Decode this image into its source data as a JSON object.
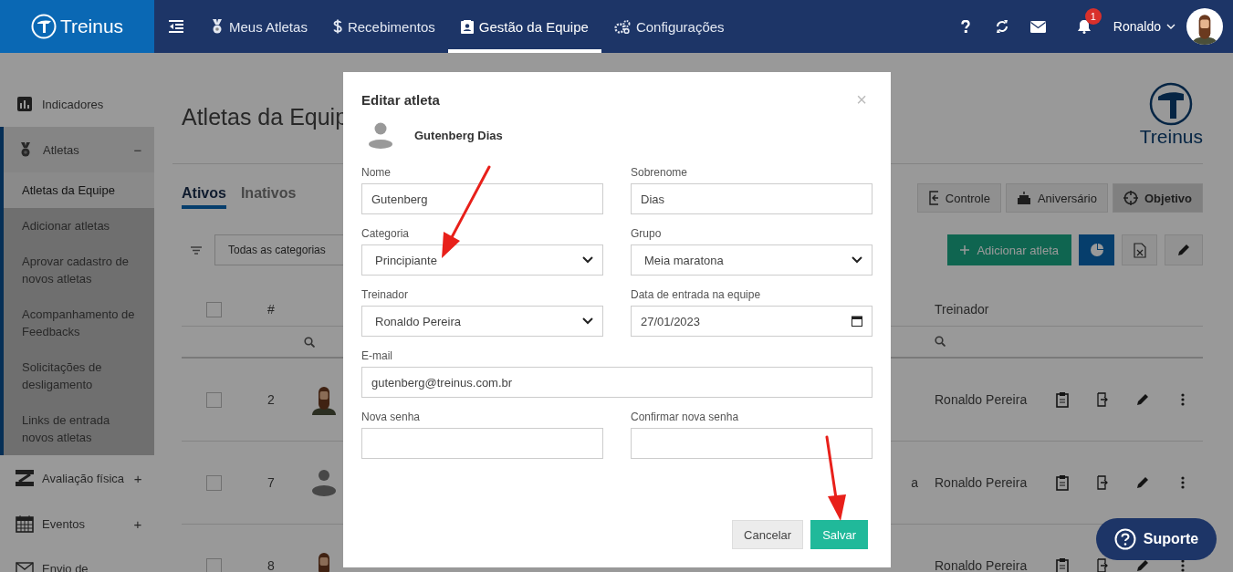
{
  "topbar": {
    "brand": "Treinus",
    "nav": [
      {
        "label": "Meus Atletas",
        "selected": false
      },
      {
        "label": "Recebimentos",
        "selected": false
      },
      {
        "label": "Gestão da Equipe",
        "selected": true
      },
      {
        "label": "Configurações",
        "selected": false
      }
    ],
    "notification_count": "1",
    "user_name": "Ronaldo"
  },
  "sidebar": {
    "items": [
      {
        "label": "Indicadores"
      },
      {
        "label": "Atletas",
        "toggle": "−",
        "expanded": true,
        "children": [
          {
            "label": "Atletas da Equipe",
            "selected": true
          },
          {
            "label": "Adicionar atletas",
            "selected": false
          },
          {
            "label": "Aprovar cadastro de novos atletas",
            "selected": false
          },
          {
            "label": "Acompanhamento de Feedbacks",
            "selected": false
          },
          {
            "label": "Solicitações de desligamento",
            "selected": false
          },
          {
            "label": "Links de entrada novos atletas",
            "selected": false
          }
        ]
      },
      {
        "label": "Avaliação física",
        "toggle": "+",
        "expanded": false
      },
      {
        "label": "Eventos",
        "toggle": "+",
        "expanded": false
      },
      {
        "label": "Envio de"
      }
    ]
  },
  "page": {
    "title": "Atletas da Equip",
    "logo_text": "Treinus",
    "tabs": [
      {
        "label": "Ativos",
        "selected": true
      },
      {
        "label": "Inativos",
        "selected": false
      }
    ],
    "view_buttons": [
      {
        "label": "Controle",
        "selected": false
      },
      {
        "label": "Aniversário",
        "selected": false
      },
      {
        "label": "Objetivo",
        "selected": true
      }
    ],
    "category_filter": {
      "value": "Todas as categorias"
    },
    "add_button": {
      "label": "Adicionar atleta"
    },
    "table": {
      "columns": [
        "#",
        "Treinador"
      ],
      "select_all_checked": false,
      "rows": [
        {
          "number": "2",
          "kind": "illustration",
          "treinador": "Ronaldo Pereira",
          "selected": false
        },
        {
          "number": "7",
          "kind": "placeholder",
          "column_5": "a",
          "treinador": "Ronaldo Pereira",
          "selected": false
        },
        {
          "number": "8",
          "kind": "illustration",
          "treinador": "Ronaldo Pereira",
          "selected": false
        }
      ]
    }
  },
  "modal": {
    "title": "Editar atleta",
    "close": "×",
    "athlete_name": "Gutenberg Dias",
    "fields": [
      {
        "label": "Nome",
        "kind": "text",
        "value": "Gutenberg"
      },
      {
        "label": "Sobrenome",
        "kind": "text",
        "value": "Dias"
      },
      {
        "label": "Categoria",
        "kind": "select",
        "value": "Principiante"
      },
      {
        "label": "Grupo",
        "kind": "select",
        "value": "Meia maratona"
      },
      {
        "label": "Treinador",
        "kind": "select",
        "value": "Ronaldo Pereira"
      },
      {
        "label": "Data de entrada na equipe",
        "kind": "date",
        "value": "27/01/2023"
      },
      {
        "label": "E-mail",
        "kind": "wide",
        "value": "gutenberg@treinus.com.br"
      },
      {
        "label": "Nova senha",
        "kind": "text"
      },
      {
        "label": "Confirmar nova senha",
        "kind": "text"
      }
    ],
    "buttons": [
      {
        "label": "Cancelar",
        "kind": "secondary"
      },
      {
        "label": "Salvar",
        "kind": "primary"
      }
    ]
  },
  "support": {
    "label": "Suporte"
  }
}
